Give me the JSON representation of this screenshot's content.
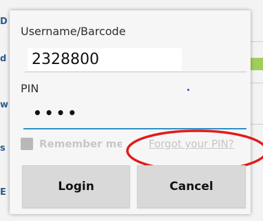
{
  "dialog": {
    "username_label": "Username/Barcode",
    "username_value": "2328800",
    "pin_label": "PIN",
    "pin_value": "••••",
    "remember_label": "Remember me",
    "forgot_link": "Forgot your PIN?",
    "login_button": "Login",
    "cancel_button": "Cancel"
  },
  "background": {
    "left_letters": [
      "D",
      "d",
      "w",
      "s",
      "E"
    ]
  },
  "colors": {
    "pin_underline": "#2b8fc7",
    "annotation_circle": "#e11b1b",
    "button_bg": "#d9d9d9"
  }
}
